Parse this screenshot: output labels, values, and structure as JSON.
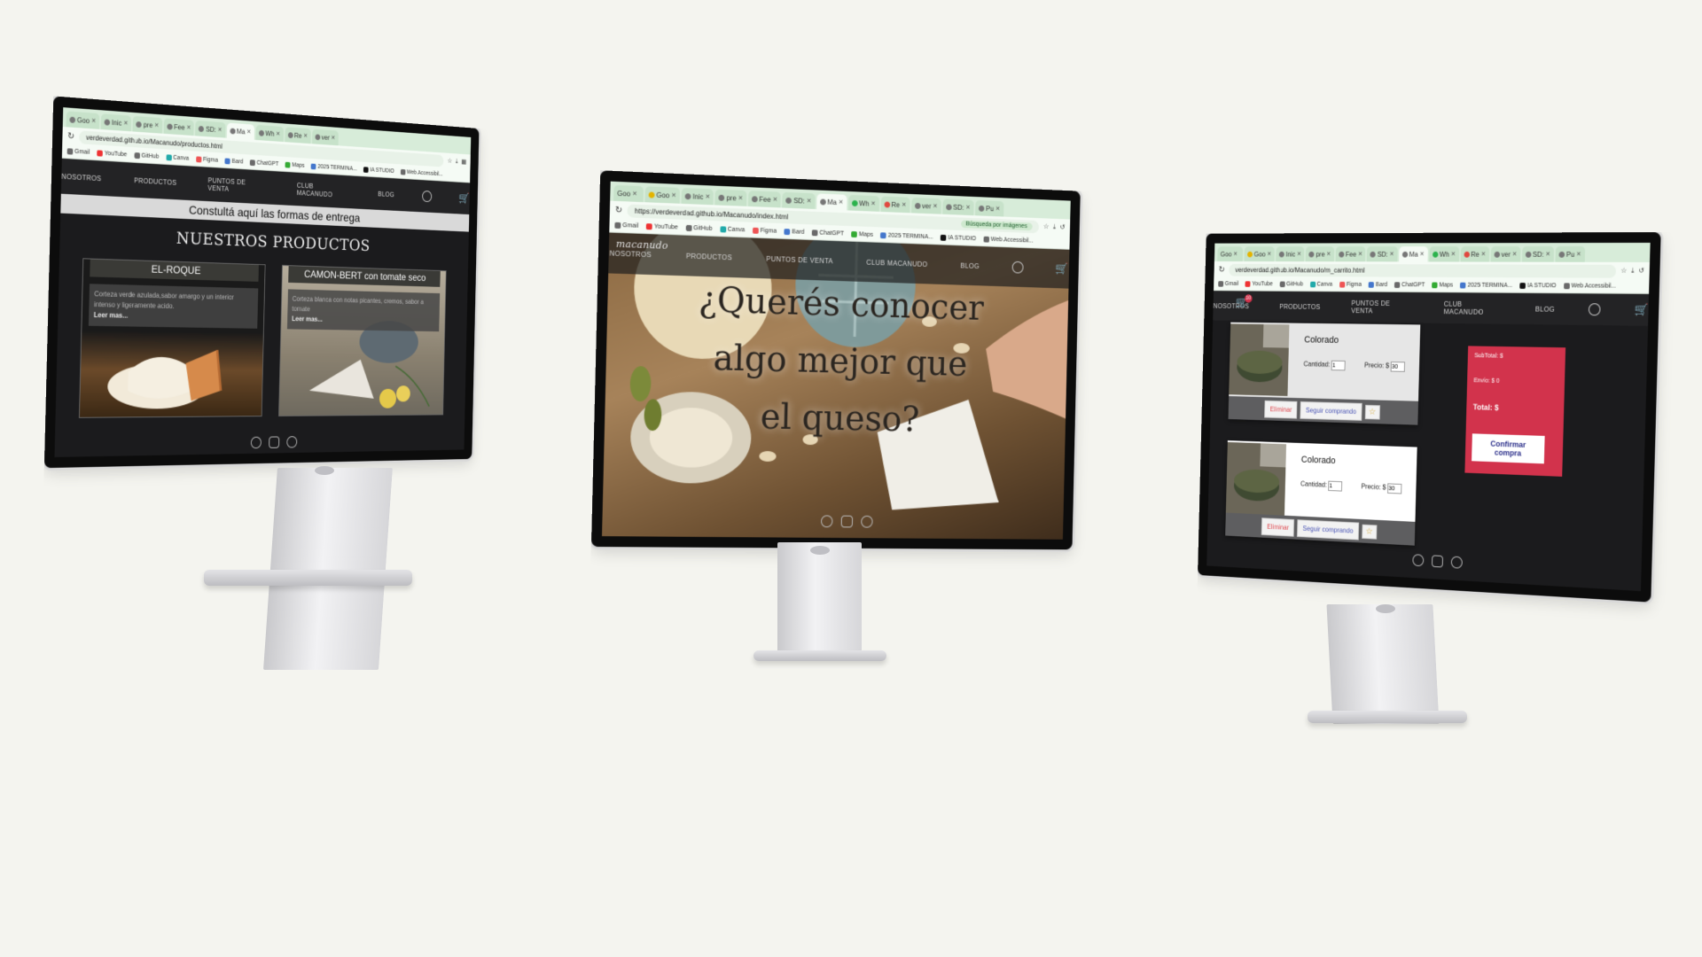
{
  "browser": {
    "tabs": [
      "Goo",
      "Inic",
      "pre",
      "Fee",
      "SD:",
      "Ma",
      "Wh",
      "Re",
      "ver",
      "SD:",
      "Pu"
    ],
    "bookmarks": [
      "Gmail",
      "YouTube",
      "GitHub",
      "Canva",
      "Figma",
      "Bard",
      "ChatGPT",
      "Maps",
      "2025 TERMINA...",
      "IA STUDIO",
      "Web Accessibil..."
    ],
    "lens_label": "Búsqueda por imágenes"
  },
  "nav": {
    "items": [
      "NOSOTROS",
      "PRODUCTOS",
      "PUNTOS DE VENTA",
      "CLUB MACANUDO",
      "BLOG"
    ],
    "logo": "macanudo"
  },
  "screen1": {
    "url": "verdeverdad.github.io/Macanudo/productos.html",
    "banner": "Constultá aquí las formas de entrega",
    "title": "NUESTROS PRODUCTOS",
    "cards": [
      {
        "title": "EL-ROQUE",
        "desc": "Corteza verde azulada,sabor amargo y un interior intenso y ligeramente acido.",
        "more": "Leer mas..."
      },
      {
        "title": "CAMON-BERT con tomate seco",
        "desc": "Corteza blanca con notas picantes, cremos, sabor a tomate",
        "more": "Leer mas..."
      }
    ]
  },
  "screen2": {
    "url": "https://verdeverdad.github.io/Macanudo/index.html",
    "hero_lines": [
      "¿Querés conocer",
      "algo mejor que",
      "el queso?"
    ]
  },
  "screen3": {
    "url": "verdeverdad.github.io/Macanudo/m_carrito.html",
    "cart_badge": "10",
    "items": [
      {
        "name": "Colorado",
        "qty_label": "Cantidad:",
        "qty": "1",
        "price_label": "Precio: $",
        "price": "30"
      },
      {
        "name": "Colorado",
        "qty_label": "Cantidad:",
        "qty": "1",
        "price_label": "Precio: $",
        "price": "30"
      }
    ],
    "buttons": {
      "remove": "Eliminar",
      "continue": "Seguir comprando",
      "fav": "☆"
    },
    "summary": {
      "subtotal": "SubTotal: $",
      "shipping": "Envío: $ 0",
      "total": "Total: $",
      "confirm": "Confirmar compra"
    }
  },
  "colors": {
    "accent_red": "#d2334c",
    "dark_bg": "#1b1b1d",
    "browser_tab_green": "#d7ecd9"
  }
}
